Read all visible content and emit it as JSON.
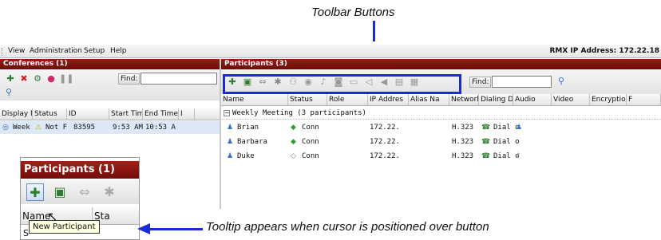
{
  "callouts": {
    "toolbar": "Toolbar Buttons",
    "tooltip": "Tooltip appears when cursor is positioned over button"
  },
  "menubar": {
    "items": [
      "View",
      "Administration",
      "Setup",
      "Help"
    ],
    "rmx_ip": "RMX IP Address: 172.22.18"
  },
  "conferences": {
    "title": "Conferences (1)",
    "find_label": "Find:",
    "columns": [
      "Display N",
      "Status",
      "ID",
      "Start Tim",
      "End Time",
      "I"
    ],
    "rows": [
      {
        "name": "Week",
        "status": "Not F",
        "id": "83595",
        "start": "9:53 AM",
        "end": "10:53 A"
      }
    ]
  },
  "participants": {
    "title": "Participants (3)",
    "find_label": "Find:",
    "columns": [
      "Name",
      "Status",
      "Role",
      "IP Addres",
      "Alias Na",
      "Network",
      "Dialing Di",
      "Audio",
      "Video",
      "Encryptio",
      "F"
    ],
    "group": "Weekly Meeting (3 participants)",
    "rows": [
      {
        "name": "Brian",
        "status": "Conn",
        "ip": "172.22.",
        "network": "H.323",
        "dial": "Dial o"
      },
      {
        "name": "Barbara",
        "status": "Conn",
        "ip": "172.22.",
        "network": "H.323",
        "dial": "Dial o"
      },
      {
        "name": "Duke",
        "status": "Conn",
        "ip": "172.22.",
        "network": "H.323",
        "dial": "Dial o"
      }
    ]
  },
  "inset": {
    "title": "Participants (1)",
    "col_name": "Name",
    "col_status": "Sta",
    "group_partial": "S",
    "tooltip": "New Participant"
  },
  "colors": {
    "panel_title": "#8b1510",
    "highlight": "#1a2bd6",
    "selected_row": "#dde8f7"
  }
}
